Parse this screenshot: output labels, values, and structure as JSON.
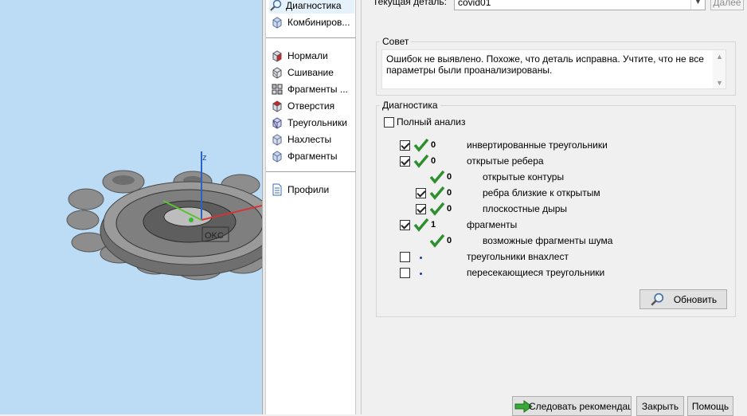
{
  "viewport": {
    "axis_label": "z",
    "model_text": "OKC"
  },
  "nav": {
    "items": [
      {
        "label": "Диагностика",
        "icon": "magnifier-icon"
      },
      {
        "label": "Комбиниров...",
        "icon": "combine-cube-icon"
      },
      {
        "label": "Нормали",
        "icon": "normals-cube-icon"
      },
      {
        "label": "Сшивание",
        "icon": "stitch-cube-icon"
      },
      {
        "label": "Фрагменты ...",
        "icon": "fragments-cube-icon"
      },
      {
        "label": "Отверстия",
        "icon": "holes-cube-icon"
      },
      {
        "label": "Треугольники",
        "icon": "triangles-cube-icon"
      },
      {
        "label": "Нахлесты",
        "icon": "overlaps-cube-icon"
      },
      {
        "label": "Фрагменты",
        "icon": "shells-cube-icon"
      },
      {
        "label": "Профили",
        "icon": "document-icon"
      }
    ]
  },
  "header": {
    "part_label": "Текущая деталь:",
    "part_value": "covid01",
    "next_label": "Далее"
  },
  "advice": {
    "title": "Совет",
    "text": "Ошибок не выявлено. Похоже, что деталь исправна. Учтите, что не все параметры были проанализированы."
  },
  "diagnostics": {
    "title": "Диагностика",
    "full_analysis": "Полный анализ",
    "rows": [
      {
        "count": "0",
        "label": "инвертированные треугольники",
        "checked": true
      },
      {
        "count": "0",
        "label": "открытые ребера",
        "checked": true
      },
      {
        "count": "0",
        "label": "открытые контуры",
        "checked": null
      },
      {
        "count": "0",
        "label": "ребра близкие к открытым",
        "checked": true
      },
      {
        "count": "0",
        "label": "плоскостные дыры",
        "checked": true
      },
      {
        "count": "1",
        "label": "фрагменты",
        "checked": true
      },
      {
        "count": "0",
        "label": "возможные фрагменты шума",
        "checked": null
      },
      {
        "count": "",
        "label": "треугольники внахлест",
        "checked": false
      },
      {
        "count": "",
        "label": "пересекающиеся треугольники",
        "checked": false
      }
    ],
    "refresh_label": "Обновить"
  },
  "footer": {
    "follow_label": "Следовать рекомендациям",
    "close_label": "Закрыть",
    "help_label": "Помощь"
  },
  "colors": {
    "accent_tick": "#2f8f2f",
    "viewport_bg": "#bcdcf5",
    "selection": "#e5f1fb"
  }
}
